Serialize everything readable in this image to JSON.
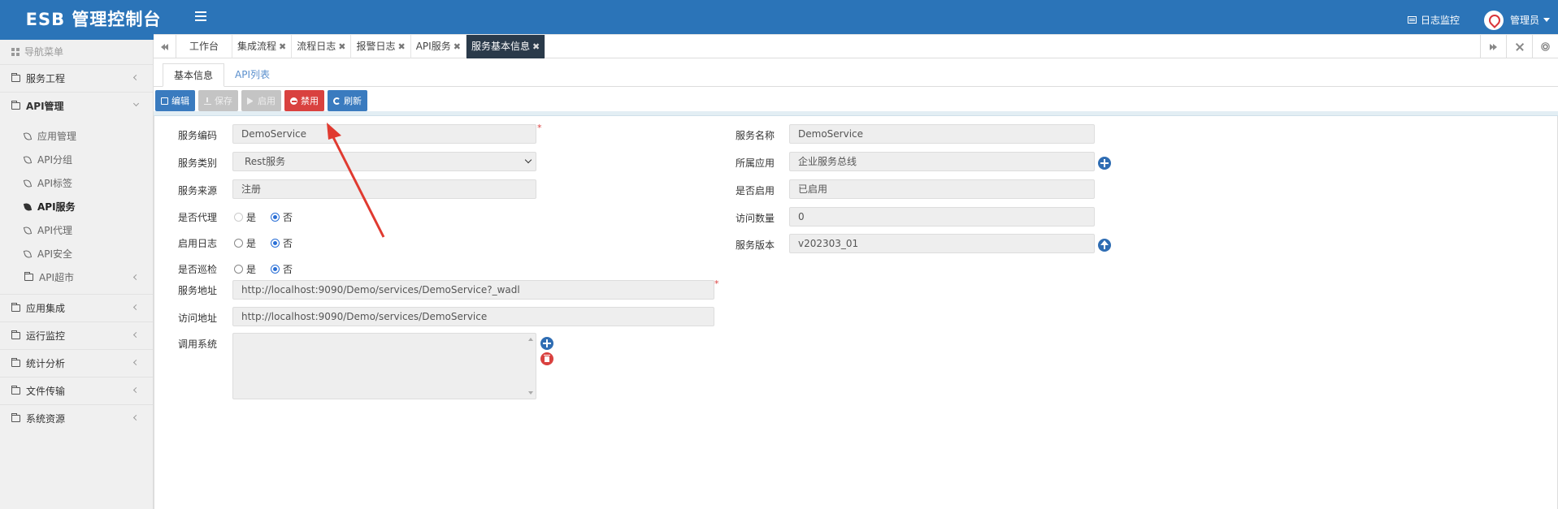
{
  "header": {
    "brand": "ESB 管理控制台",
    "log_monitor": "日志监控",
    "user": "管理员",
    "bg_color": "#2b74b8"
  },
  "sidebar": {
    "nav_title": "导航菜单",
    "items": [
      {
        "label": "服务工程",
        "icon": "folder-icon"
      },
      {
        "label": "API管理",
        "icon": "folder-icon"
      },
      {
        "label": "应用集成",
        "icon": "folder-icon"
      },
      {
        "label": "运行监控",
        "icon": "folder-icon"
      },
      {
        "label": "统计分析",
        "icon": "folder-icon"
      },
      {
        "label": "文件传输",
        "icon": "folder-icon"
      },
      {
        "label": "系统资源",
        "icon": "folder-icon"
      }
    ],
    "api_sub": [
      {
        "label": "应用管理"
      },
      {
        "label": "API分组"
      },
      {
        "label": "API标签"
      },
      {
        "label": "API服务"
      },
      {
        "label": "API代理"
      },
      {
        "label": "API安全"
      },
      {
        "label": "API超市"
      }
    ]
  },
  "tabs": [
    {
      "label": "工作台"
    },
    {
      "label": "集成流程"
    },
    {
      "label": "流程日志"
    },
    {
      "label": "报警日志"
    },
    {
      "label": "API服务"
    },
    {
      "label": "服务基本信息"
    }
  ],
  "subtabs": [
    "基本信息",
    "API列表"
  ],
  "toolbar": {
    "edit": "编辑",
    "save": "保存",
    "enable": "启用",
    "disable": "禁用",
    "refresh": "刷新"
  },
  "form": {
    "service_code_label": "服务编码",
    "service_code": "DemoService",
    "service_type_label": "服务类别",
    "service_type": "Rest服务",
    "service_source_label": "服务来源",
    "service_source": "注册",
    "proxy_label": "是否代理",
    "log_label": "启用日志",
    "patrol_label": "是否巡检",
    "yes": "是",
    "no": "否",
    "service_addr_label": "服务地址",
    "service_addr": "http://localhost:9090/Demo/services/DemoService?_wadl",
    "access_addr_label": "访问地址",
    "access_addr": "http://localhost:9090/Demo/services/DemoService",
    "caller_label": "调用系统",
    "service_name_label": "服务名称",
    "service_name": "DemoService",
    "app_label": "所属应用",
    "app": "企业服务总线",
    "enabled_label": "是否启用",
    "enabled": "已启用",
    "access_count_label": "访问数量",
    "access_count": "0",
    "version_label": "服务版本",
    "version": "v202303_01",
    "required_mark": "*"
  }
}
